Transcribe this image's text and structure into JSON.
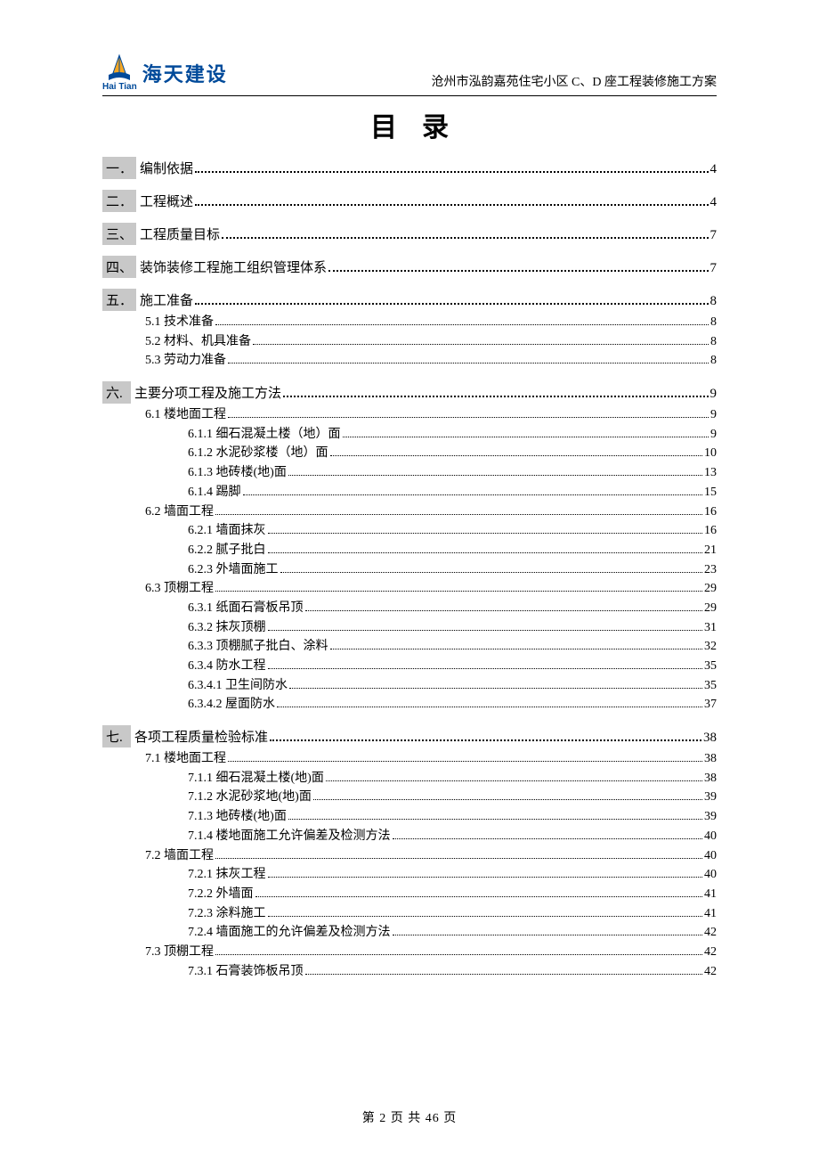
{
  "header": {
    "brand": "海天建设",
    "brand_en": "Hai Tian",
    "right": "沧州市泓韵嘉苑住宅小区 C、D 座工程装修施工方案"
  },
  "title": "目录",
  "toc": [
    {
      "level": 1,
      "num": "一．",
      "label": "编制依据",
      "page": "4"
    },
    {
      "level": 1,
      "num": "二．",
      "label": "工程概述",
      "page": "4"
    },
    {
      "level": 1,
      "num": "三、",
      "label": "工程质量目标",
      "page": "7"
    },
    {
      "level": 1,
      "num": "四、",
      "label": "装饰装修工程施工组织管理体系",
      "page": "7"
    },
    {
      "level": 1,
      "num": "五．",
      "label": "施工准备",
      "page": "8"
    },
    {
      "level": 2,
      "label": "5.1 技术准备",
      "page": "8"
    },
    {
      "level": 2,
      "label": "5.2 材料、机具准备",
      "page": "8"
    },
    {
      "level": 2,
      "label": "5.3 劳动力准备",
      "page": "8"
    },
    {
      "level": 1,
      "num": "六.",
      "label": "主要分项工程及施工方法",
      "page": "9"
    },
    {
      "level": 2,
      "label": "6.1 楼地面工程",
      "page": "9"
    },
    {
      "level": 3,
      "label": "6.1.1 细石混凝土楼（地）面",
      "page": "9"
    },
    {
      "level": 3,
      "label": "6.1.2 水泥砂浆楼（地）面",
      "page": "10"
    },
    {
      "level": 3,
      "label": "6.1.3 地砖楼(地)面",
      "page": "13"
    },
    {
      "level": 3,
      "label": "6.1.4 踢脚",
      "page": "15"
    },
    {
      "level": 2,
      "label": "6.2 墙面工程",
      "page": "16"
    },
    {
      "level": 3,
      "label": "6.2.1 墙面抹灰",
      "page": "16"
    },
    {
      "level": 3,
      "label": "6.2.2 腻子批白",
      "page": "21"
    },
    {
      "level": 3,
      "label": "6.2.3 外墙面施工",
      "page": "23"
    },
    {
      "level": 2,
      "label": "6.3 顶棚工程",
      "page": "29"
    },
    {
      "level": 3,
      "label": "6.3.1 纸面石膏板吊顶",
      "page": "29"
    },
    {
      "level": 3,
      "label": "6.3.2 抹灰顶棚",
      "page": "31"
    },
    {
      "level": 3,
      "label": "6.3.3 顶棚腻子批白、涂料",
      "page": "32"
    },
    {
      "level": 3,
      "label": "6.3.4 防水工程",
      "page": "35"
    },
    {
      "level": 3,
      "label": "6.3.4.1 卫生间防水",
      "page": "35"
    },
    {
      "level": 3,
      "label": "6.3.4.2 屋面防水",
      "page": "37"
    },
    {
      "level": 1,
      "num": "七.",
      "label": "各项工程质量检验标准",
      "page": "38"
    },
    {
      "level": 2,
      "label": "7.1 楼地面工程",
      "page": "38"
    },
    {
      "level": 3,
      "label": "7.1.1 细石混凝土楼(地)面",
      "page": "38"
    },
    {
      "level": 3,
      "label": "7.1.2 水泥砂浆地(地)面",
      "page": "39"
    },
    {
      "level": 3,
      "label": "7.1.3 地砖楼(地)面",
      "page": "39"
    },
    {
      "level": 3,
      "label": "7.1.4 楼地面施工允许偏差及检测方法",
      "page": "40"
    },
    {
      "level": 2,
      "label": "7.2 墙面工程",
      "page": "40"
    },
    {
      "level": 3,
      "label": "7.2.1 抹灰工程",
      "page": "40"
    },
    {
      "level": 3,
      "label": "7.2.2 外墙面",
      "page": "41"
    },
    {
      "level": 3,
      "label": "7.2.3 涂料施工",
      "page": "41"
    },
    {
      "level": 3,
      "label": "7.2.4 墙面施工的允许偏差及检测方法",
      "page": "42"
    },
    {
      "level": 2,
      "label": "7.3 顶棚工程",
      "page": "42"
    },
    {
      "level": 3,
      "label": "7.3.1 石膏装饰板吊顶",
      "page": "42"
    }
  ],
  "footer": "第 2 页 共 46 页"
}
